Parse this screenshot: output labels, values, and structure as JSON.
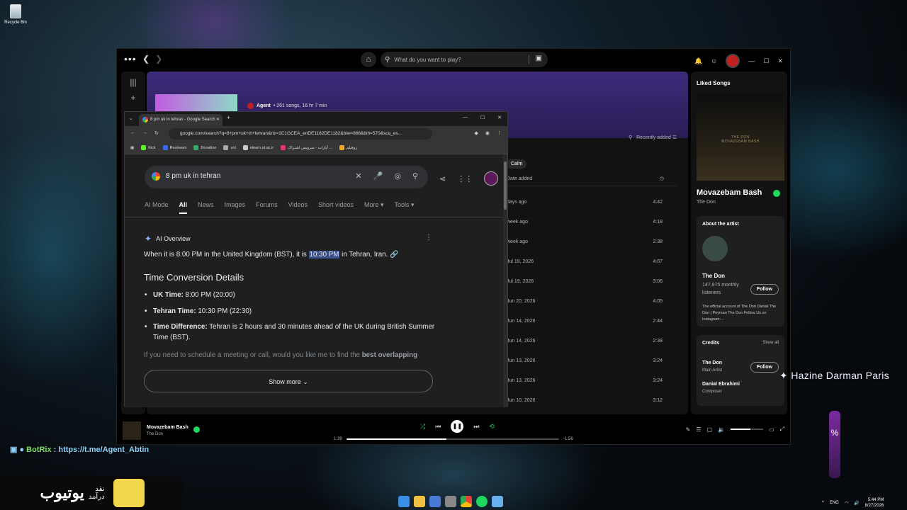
{
  "desktop": {
    "recycle_bin": "Recycle Bin",
    "overlay_name": "Hazine Darman Paris",
    "overlay_pct": "%",
    "overlay_level": 1.0,
    "botrix_name": "BotRix",
    "botrix_text": ": https://t.me/Agent_Abtin",
    "yt_big": "یوتیوب",
    "yt_small1": "نقد",
    "yt_small2": "درآمد"
  },
  "taskbar": {
    "lang": "ENG",
    "time": "5:44 PM",
    "date": "8/27/2026"
  },
  "spotify": {
    "search_placeholder": "What do you want to play?",
    "playlist_owner": "Agent",
    "playlist_meta": " • 261 songs, 16 hr 7 min",
    "sort_label": "Recently added",
    "filter_chip": "Calm",
    "col_date": "Date added",
    "rows": [
      {
        "date": "days ago",
        "dur": "4:42"
      },
      {
        "date": "week ago",
        "dur": "4:18"
      },
      {
        "date": "week ago",
        "dur": "2:38"
      },
      {
        "date": "Jul 19, 2026",
        "dur": "4:07"
      },
      {
        "date": "Jul 19, 2026",
        "dur": "3:06"
      },
      {
        "date": "Jun 20, 2026",
        "dur": "4:05"
      },
      {
        "date": "Jun 14, 2026",
        "dur": "2:44"
      },
      {
        "date": "Jun 14, 2026",
        "dur": "2:38"
      },
      {
        "date": "Jun 13, 2026",
        "dur": "3:24"
      },
      {
        "date": "Jun 13, 2026",
        "dur": "3:24"
      },
      {
        "date": "Jun 10, 2026",
        "dur": "3:12"
      }
    ],
    "right_panel": {
      "title": "Liked Songs",
      "art_text": "THE DON\nMOVAZEBAM BASH",
      "song": "Movazebam Bash",
      "artist": "The Don",
      "about_header": "About the artist",
      "about_name": "The Don",
      "listeners": "147,975 monthly listeners",
      "follow": "Follow",
      "bio": "The official account of The Don Danial The Don | Peyman The Don Follow Us on Instagram:...",
      "credits_header": "Credits",
      "show_all": "Show all",
      "credit1_name": "The Don",
      "credit1_role": "Main Artist",
      "credit2_name": "Danial Ebrahimi",
      "credit2_role": "Composer"
    },
    "player": {
      "title": "Movazebam Bash",
      "artist": "The Don",
      "elapsed": "1:39",
      "remaining": "-1:56",
      "progress": 0.47,
      "volume": 0.6
    }
  },
  "chrome": {
    "tab_title": "8 pm uk in tehran - Google Search",
    "url": "google.com/search?q=8+pm+uk+in+tehran&rlz=1C1GCEA_enDE1182DE1182&biw=866&bih=570&sca_es...",
    "bookmarks": [
      "Kick",
      "Restream",
      "Donation",
      "uni",
      "elearn.ut.ac.ir",
      "آپارات - سرویس اشتراک ...",
      "زوفیلم"
    ],
    "query": "8 pm uk in tehran",
    "tabs": [
      "AI Mode",
      "All",
      "News",
      "Images",
      "Forums",
      "Videos",
      "Short videos",
      "More ▾",
      "Tools ▾"
    ],
    "ai_overview": "AI Overview",
    "answer_pre": "When it is 8:00 PM in the United Kingdom (BST), it is ",
    "answer_mark": "10:30 PM",
    "answer_post": " in Tehran, Iran.",
    "details_title": "Time Conversion Details",
    "uk_label": "UK Time:",
    "uk_val": " 8:00 PM (20:00)",
    "tehran_label": "Tehran Time:",
    "tehran_val": " 10:30 PM (22:30)",
    "diff_label": "Time Difference:",
    "diff_val": " Tehran is 2 hours and 30 minutes ahead of the UK during British Summer Time (BST).",
    "fade_pre": "If you need to schedule a meeting or call, would you like me to find the ",
    "fade_bold": "best overlapping",
    "show_more": "Show more"
  }
}
